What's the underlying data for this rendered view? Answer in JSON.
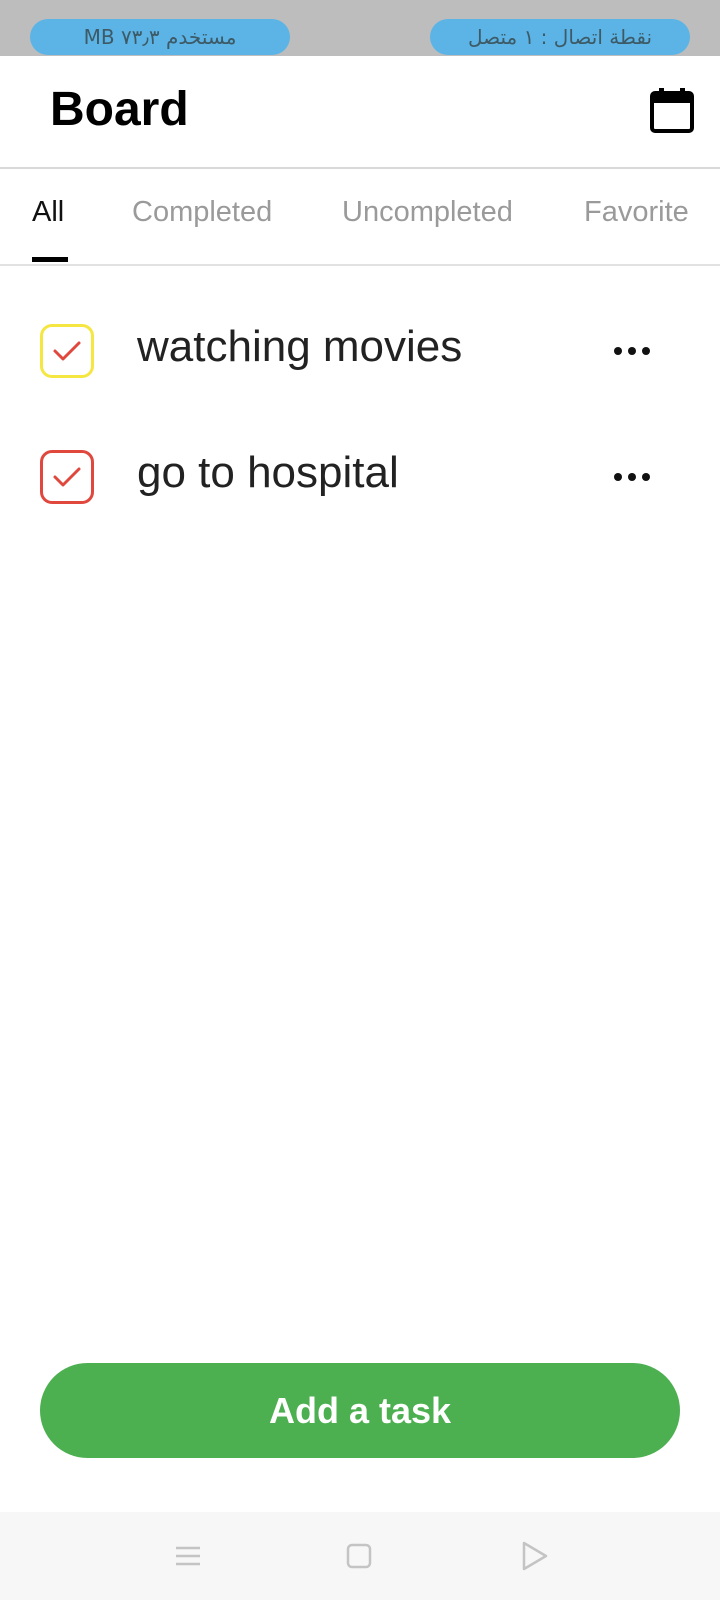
{
  "status_bar": {
    "left_pill": "مستخدم ٧٣٫٣ MB",
    "right_pill": "نقطة اتصال : ١ متصل"
  },
  "header": {
    "title": "Board",
    "calendar_icon": "calendar-icon"
  },
  "tabs": [
    {
      "label": "All",
      "active": true
    },
    {
      "label": "Completed",
      "active": false
    },
    {
      "label": "Uncompleted",
      "active": false
    },
    {
      "label": "Favorite",
      "active": false
    }
  ],
  "tasks": [
    {
      "title": "watching movies",
      "checked": true,
      "color": "#f5e642"
    },
    {
      "title": "go to hospital",
      "checked": true,
      "color": "#e0483e"
    }
  ],
  "add_button": {
    "label": "Add a task",
    "color": "#4caf50"
  },
  "nav_bar": {
    "menu_icon": "menu-icon",
    "home_icon": "home-square-icon",
    "back_icon": "back-triangle-icon"
  }
}
